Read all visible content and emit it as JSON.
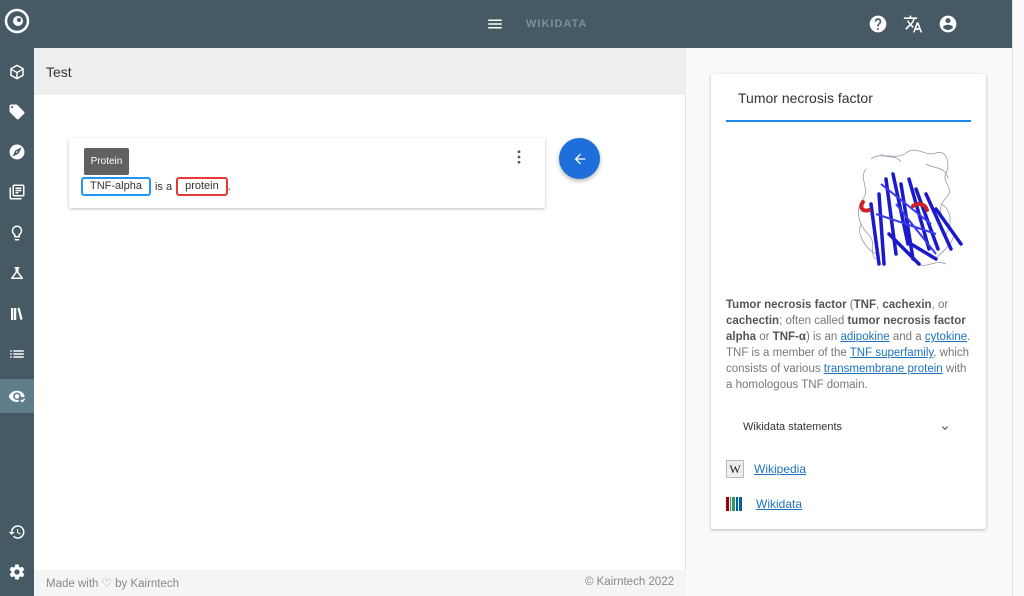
{
  "topbar": {
    "brand": "WIKIDATA"
  },
  "pane": {
    "title": "Test"
  },
  "card": {
    "tooltip": "Protein",
    "entity1": "TNF-alpha",
    "connector": "is a",
    "entity2": "protein",
    "period": "."
  },
  "footer": {
    "left": "Made with ♡ by Kairntech",
    "right": "©    Kairntech 2022"
  },
  "info": {
    "title": "Tumor necrosis factor",
    "desc": {
      "t1": "Tumor necrosis factor",
      "t2": " (",
      "t3": "TNF",
      "t4": ", ",
      "t5": "cachexin",
      "t6": ", or ",
      "t7": "cachectin",
      "t8": "; often called ",
      "t9": "tumor necrosis factor alpha",
      "t10": " or ",
      "t11": "TNF-α",
      "t12": ") is an ",
      "l1": "adipokine",
      "t13": " and a ",
      "l2": "cytokine",
      "t14": ". TNF is a member of the ",
      "l3": "TNF superfamily",
      "t15": ", which consists of various ",
      "l4": "transmembrane protein",
      "t16": " with a homologous TNF domain."
    },
    "statements_label": "Wikidata statements",
    "links": {
      "wikipedia": "Wikipedia",
      "wikidata": "Wikidata"
    }
  },
  "icons": {
    "sidebar": [
      "logo-eye-icon",
      "cube-icon",
      "tag-icon",
      "compass-icon",
      "documents-icon",
      "lightbulb-icon",
      "flask-icon",
      "library-icon",
      "list-icon",
      "eye-check-icon",
      "history-icon",
      "gear-icon"
    ],
    "topbar": [
      "menu-icon",
      "help-icon",
      "translate-icon",
      "account-icon"
    ]
  },
  "colors": {
    "header": "#455a64",
    "accent": "#1e6fd9",
    "entity_blue": "#2196f3",
    "entity_red": "#e53935"
  }
}
